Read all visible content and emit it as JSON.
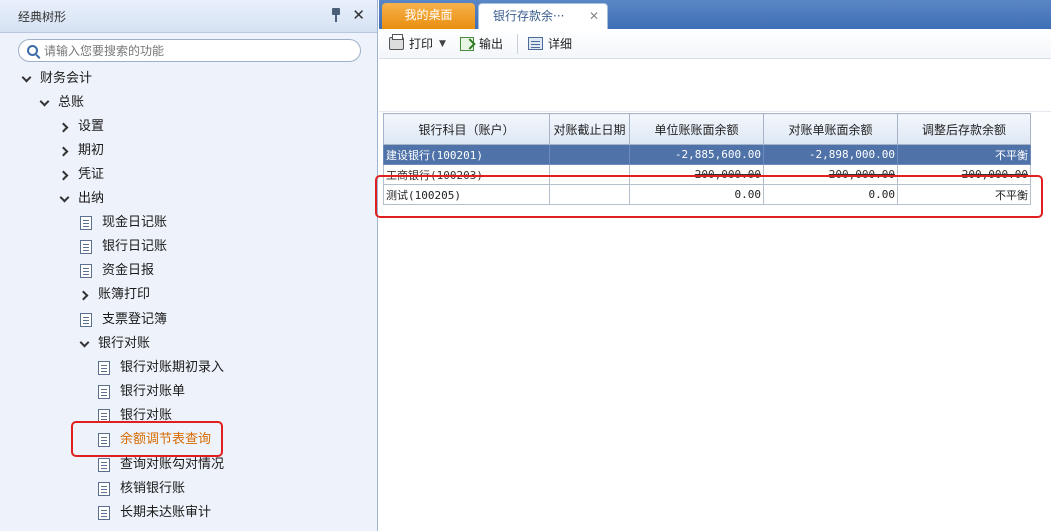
{
  "left_panel": {
    "title": "经典树形",
    "search_placeholder": "请输入您要搜索的功能",
    "tree": [
      {
        "label": "财务会计",
        "expander": "down"
      },
      {
        "label": "总账",
        "expander": "down"
      },
      {
        "label": "设置",
        "expander": "right"
      },
      {
        "label": "期初",
        "expander": "right"
      },
      {
        "label": "凭证",
        "expander": "right"
      },
      {
        "label": "出纳",
        "expander": "down"
      },
      {
        "label": "现金日记账",
        "expander": "doc"
      },
      {
        "label": "银行日记账",
        "expander": "doc"
      },
      {
        "label": "资金日报",
        "expander": "doc"
      },
      {
        "label": "账簿打印",
        "expander": "right"
      },
      {
        "label": "支票登记簿",
        "expander": "doc"
      },
      {
        "label": "银行对账",
        "expander": "down"
      },
      {
        "label": "银行对账期初录入",
        "expander": "doc"
      },
      {
        "label": "银行对账单",
        "expander": "doc"
      },
      {
        "label": "银行对账",
        "expander": "doc"
      },
      {
        "label": "余额调节表查询",
        "expander": "doc",
        "active": true
      },
      {
        "label": "查询对账勾对情况",
        "expander": "doc"
      },
      {
        "label": "核销银行账",
        "expander": "doc"
      },
      {
        "label": "长期未达账审计",
        "expander": "doc"
      }
    ]
  },
  "tabs": [
    {
      "label": "我的桌面"
    },
    {
      "label": "银行存款余···"
    }
  ],
  "toolbar": {
    "print": "打印",
    "export": "输出",
    "detail": "详细"
  },
  "grid": {
    "headers": [
      "银行科目（账户）",
      "对账截止日期",
      "单位账账面余额",
      "对账单账面余额",
      "调整后存款余额"
    ],
    "rows": [
      [
        "建设银行(100201)",
        "",
        "-2,885,600.00",
        "-2,898,000.00",
        "不平衡"
      ],
      [
        "工商银行(100203)",
        "",
        "200,000.00",
        "200,000.00",
        "200,000.00"
      ],
      [
        "测试(100205)",
        "",
        "0.00",
        "0.00",
        "不平衡"
      ]
    ]
  },
  "colors": {
    "selected_row": "#4f72a8",
    "highlight_box": "#e02020",
    "active_item": "#d86a00",
    "home_tab": "#f0a030"
  }
}
